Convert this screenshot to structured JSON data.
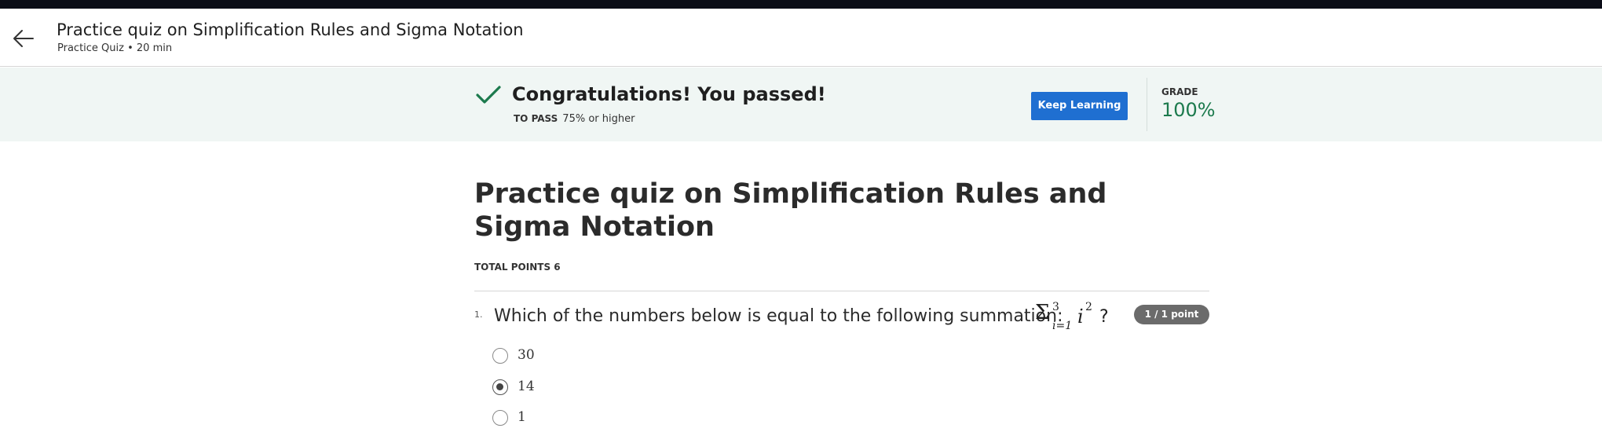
{
  "header": {
    "title": "Practice quiz on Simplification Rules and Sigma Notation",
    "subtitle": "Practice Quiz • 20 min"
  },
  "banner": {
    "message": "Congratulations! You passed!",
    "to_pass_label": "TO PASS",
    "to_pass_value": "75% or higher",
    "keep_learning_label": "Keep Learning",
    "grade_label": "GRADE",
    "grade_value": "100%",
    "colors": {
      "background": "#f0f6f4",
      "accent_green": "#1c7a4d",
      "button_blue": "#1f6fd1"
    }
  },
  "main": {
    "title": "Practice quiz on Simplification Rules and Sigma Notation",
    "total_points": "TOTAL POINTS 6"
  },
  "question": {
    "number": "1.",
    "text": "Which of the numbers below is equal to the following summation:",
    "math": {
      "sigma": "Σ",
      "upper": "3",
      "lower": "i=1",
      "term": "i",
      "exponent": "2",
      "suffix": "?"
    },
    "points": "1 / 1 point",
    "options": [
      {
        "label": "30",
        "selected": false
      },
      {
        "label": "14",
        "selected": true
      },
      {
        "label": "1",
        "selected": false
      }
    ]
  }
}
